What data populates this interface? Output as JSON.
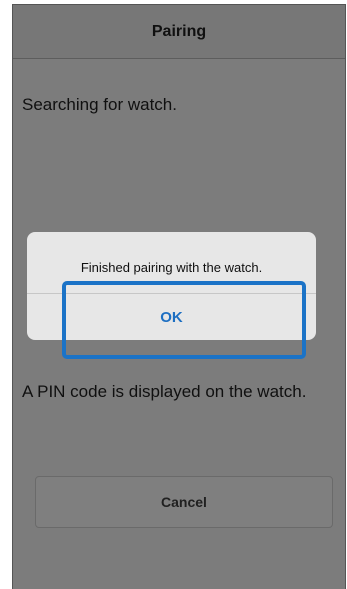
{
  "header": {
    "title": "Pairing"
  },
  "status": {
    "searching": "Searching for watch."
  },
  "alert": {
    "message": "Finished pairing with the watch.",
    "ok_label": "OK"
  },
  "pin": {
    "message": "A PIN code is displayed on the watch."
  },
  "actions": {
    "cancel_label": "Cancel"
  },
  "colors": {
    "accent": "#1d6fc2",
    "highlight": "#1b73c7"
  }
}
